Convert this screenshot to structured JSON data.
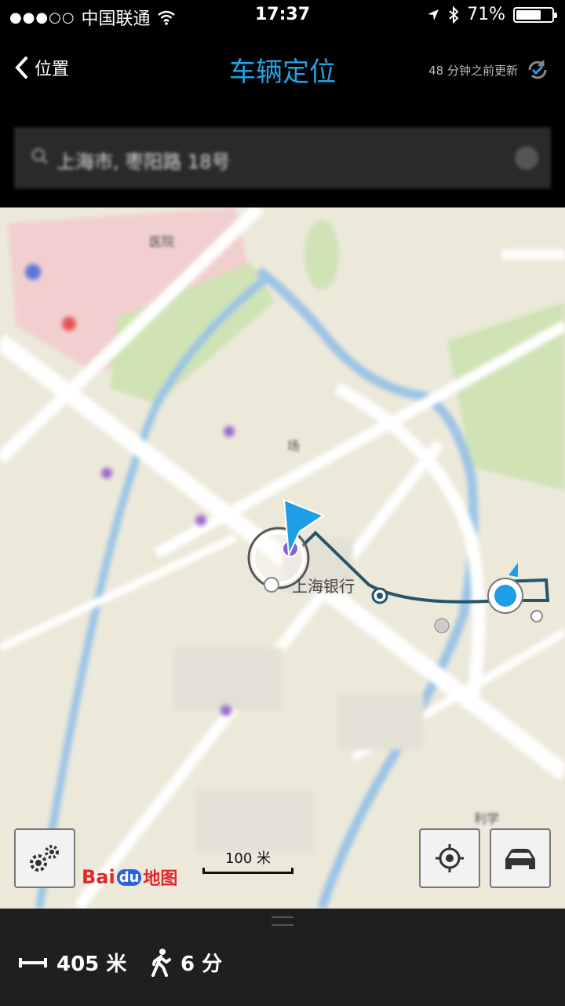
{
  "status_bar": {
    "signal_dots": "●●●○○",
    "carrier": "中国联通",
    "time": "17:37",
    "battery": "71%",
    "battery_level": 0.71
  },
  "nav": {
    "back_label": "位置",
    "title": "车辆定位",
    "updated_text": "48 分钟之前更新"
  },
  "search": {
    "value": "上海市, 枣阳路 18号"
  },
  "map": {
    "poi_labels": {
      "shanghai_bank": "上海银行",
      "market": "场",
      "hospital": "医院",
      "school": "利学"
    },
    "scale_label": "100 米",
    "logo_bai": "Bai",
    "logo_du": "du",
    "logo_map": "地图"
  },
  "footer": {
    "distance": "405 米",
    "walk_time": "6 分"
  },
  "colors": {
    "accent": "#1ea3e6",
    "route": "#23556b",
    "map_bg": "#ece9da"
  }
}
